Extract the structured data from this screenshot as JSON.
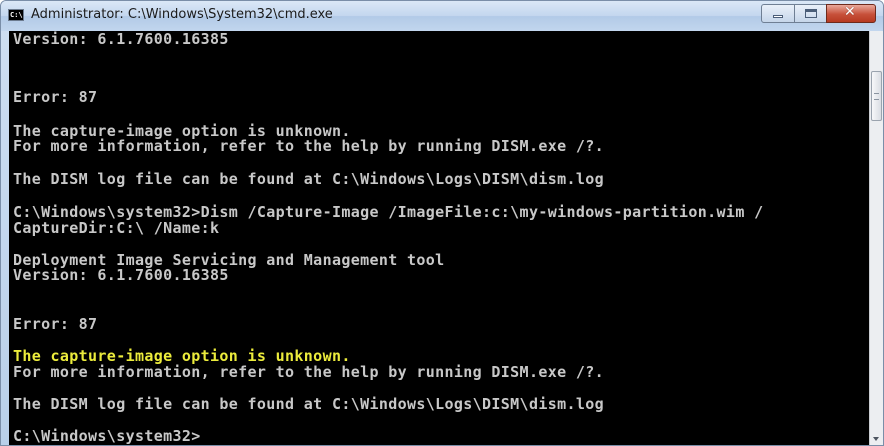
{
  "window": {
    "title": "Administrator: C:\\Windows\\System32\\cmd.exe",
    "app_icon_text": "C:\\",
    "close_glyph": "✕"
  },
  "console": {
    "lines": [
      "Version: 6.1.7600.16385",
      "Error: 87",
      "The capture-image option is unknown.",
      "For more information, refer to the help by running DISM.exe /?.",
      "The DISM log file can be found at C:\\Windows\\Logs\\DISM\\dism.log",
      "C:\\Windows\\system32>Dism /Capture-Image /ImageFile:c:\\my-windows-partition.wim /",
      "CaptureDir:C:\\ /Name:k",
      "Deployment Image Servicing and Management tool",
      "Version: 6.1.7600.16385",
      "Error: 87",
      "The capture-image option is unknown.",
      "For more information, refer to the help by running DISM.exe /?.",
      "The DISM log file can be found at C:\\Windows\\Logs\\DISM\\dism.log",
      "C:\\Windows\\system32>"
    ],
    "text_color": "#c8c8c8",
    "highlight_color": "#ecec3c",
    "background": "#000000"
  }
}
